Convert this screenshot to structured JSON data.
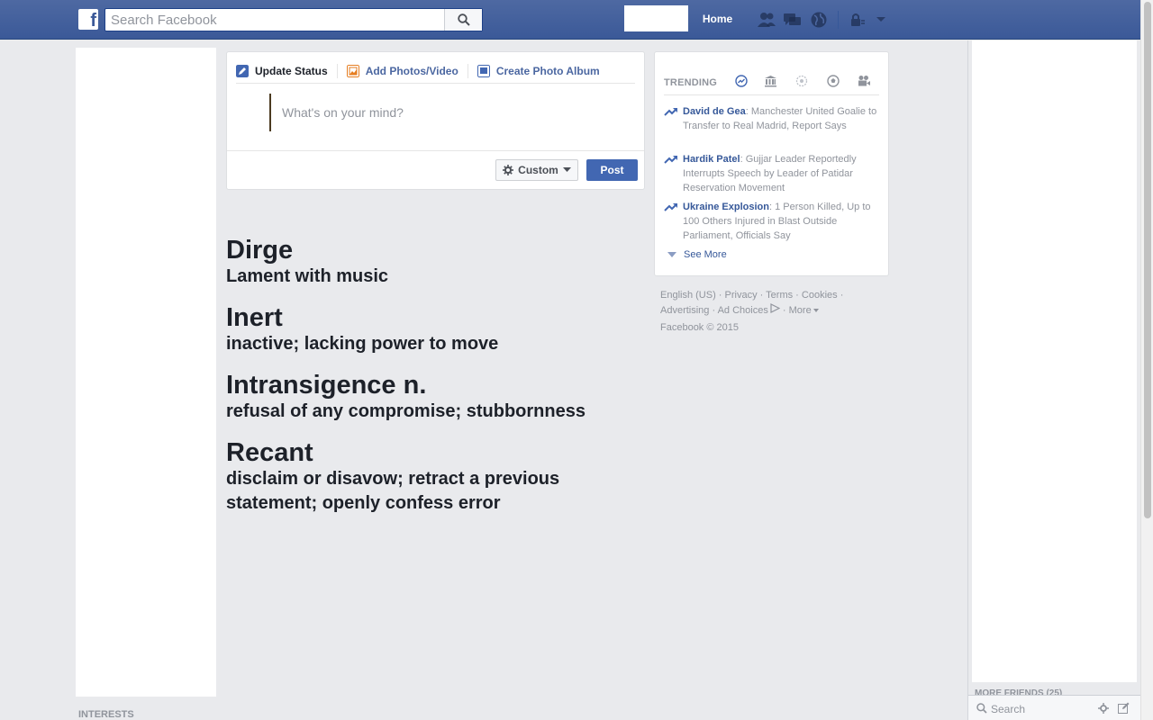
{
  "header": {
    "logo_letter": "f",
    "search_placeholder": "Search Facebook",
    "home_label": "Home"
  },
  "composer": {
    "tabs": [
      {
        "label": "Update Status",
        "icon": "pencil-icon",
        "color": "#4267b2"
      },
      {
        "label": "Add Photos/Video",
        "icon": "photo-icon",
        "color": "#e67e22"
      },
      {
        "label": "Create Photo Album",
        "icon": "album-icon",
        "color": "#4267b2"
      }
    ],
    "placeholder": "What's on your mind?",
    "privacy_label": "Custom",
    "post_label": "Post"
  },
  "vocab": [
    {
      "term": "Dirge",
      "definition": "Lament with music"
    },
    {
      "term": "Inert",
      "definition": "inactive; lacking power to move"
    },
    {
      "term": "Intransigence n.",
      "definition": "refusal of any compromise; stubbornness"
    },
    {
      "term": "Recant",
      "definition": "disclaim or disavow; retract a previous statement; openly confess error"
    }
  ],
  "trending": {
    "title": "TRENDING",
    "items": [
      {
        "name": "David de Gea",
        "text": ": Manchester United Goalie to Transfer to Real Madrid, Report Says"
      },
      {
        "name": "Hardik Patel",
        "text": ": Gujjar Leader Reportedly Interrupts Speech by Leader of Patidar Reservation Movement"
      },
      {
        "name": "Ukraine Explosion",
        "text": ": 1 Person Killed, Up to 100 Others Injured in Blast Outside Parliament, Officials Say"
      }
    ],
    "see_more": "See More"
  },
  "footer": {
    "links": [
      "English (US)",
      "Privacy",
      "Terms",
      "Cookies",
      "Advertising",
      "Ad Choices",
      "More"
    ],
    "copyright": "Facebook © 2015"
  },
  "left": {
    "interests_label": "INTERESTS"
  },
  "chat": {
    "more_friends": "MORE FRIENDS (25)",
    "search_placeholder": "Search"
  },
  "colors": {
    "brand": "#3b5998",
    "link": "#365899",
    "background": "#e9eaed"
  }
}
